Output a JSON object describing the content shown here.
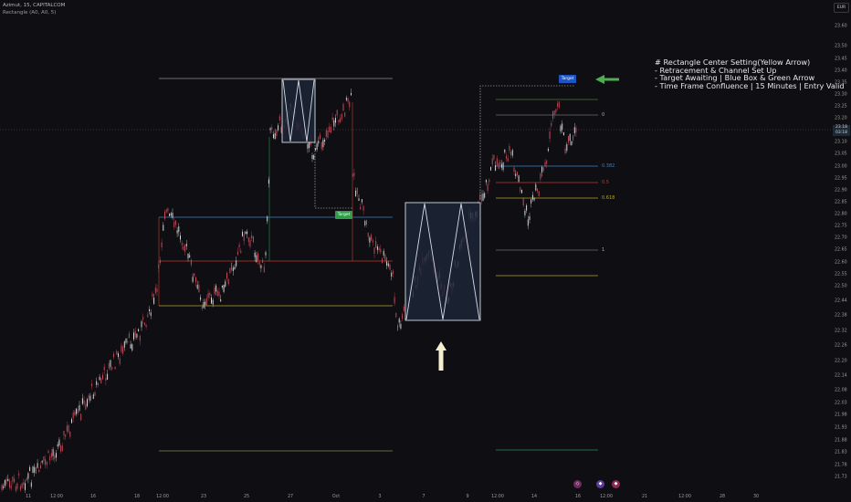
{
  "header": {
    "symbol_line": "Azimut, 15, CAPITALCOM",
    "indicator_line": "Rectangle (A0, A0, 5)"
  },
  "currency_button": "EUR",
  "price_axis": [
    {
      "value": 23.6,
      "label": "23.60"
    },
    {
      "value": 23.5,
      "label": "23.50"
    },
    {
      "value": 23.45,
      "label": "23.45"
    },
    {
      "value": 23.4,
      "label": "23.40"
    },
    {
      "value": 23.35,
      "label": "23.35"
    },
    {
      "value": 23.3,
      "label": "23.30"
    },
    {
      "value": 23.25,
      "label": "23.25"
    },
    {
      "value": 23.2,
      "label": "23.20"
    },
    {
      "value": 23.1,
      "label": "23.10"
    },
    {
      "value": 23.05,
      "label": "23.05"
    },
    {
      "value": 23.0,
      "label": "23.00"
    },
    {
      "value": 22.95,
      "label": "22.95"
    },
    {
      "value": 22.9,
      "label": "22.90"
    },
    {
      "value": 22.85,
      "label": "22.85"
    },
    {
      "value": 22.8,
      "label": "22.80"
    },
    {
      "value": 22.75,
      "label": "22.75"
    },
    {
      "value": 22.7,
      "label": "22.70"
    },
    {
      "value": 22.65,
      "label": "22.65"
    },
    {
      "value": 22.6,
      "label": "22.60"
    },
    {
      "value": 22.55,
      "label": "22.55"
    },
    {
      "value": 22.5,
      "label": "22.50"
    },
    {
      "value": 22.44,
      "label": "22.44"
    },
    {
      "value": 22.38,
      "label": "22.38"
    },
    {
      "value": 22.32,
      "label": "22.32"
    },
    {
      "value": 22.26,
      "label": "22.26"
    },
    {
      "value": 22.2,
      "label": "22.20"
    },
    {
      "value": 22.14,
      "label": "22.14"
    },
    {
      "value": 22.08,
      "label": "22.08"
    },
    {
      "value": 22.03,
      "label": "22.03"
    },
    {
      "value": 21.98,
      "label": "21.98"
    },
    {
      "value": 21.93,
      "label": "21.93"
    },
    {
      "value": 21.88,
      "label": "21.88"
    },
    {
      "value": 21.83,
      "label": "21.83"
    },
    {
      "value": 21.78,
      "label": "21.78"
    },
    {
      "value": 21.73,
      "label": "21.73"
    }
  ],
  "price_tag": {
    "line1": "23.18",
    "line2": "03:18"
  },
  "time_axis": [
    "11",
    "12:00",
    "16",
    "18",
    "12:00",
    "23",
    "25",
    "27",
    "Oct",
    "3",
    "7",
    "9",
    "12:00",
    "14",
    "16",
    "12:00",
    "21",
    "12:00",
    "28",
    "30"
  ],
  "fib_labels": [
    "0",
    "0.382",
    "0.5",
    "0.618",
    "1"
  ],
  "badges": {
    "green": "Target",
    "blue": "Target"
  },
  "note_lines": [
    "# Rectangle Center Setting(Yellow Arrow)",
    "- Retracement & Channel Set Up",
    "- Target Awaiting | Blue Box & Green Arrow",
    "- Time Frame Confluence | 15 Minutes | Entry Valid"
  ],
  "event_icons": [
    "dividend-icon",
    "earnings-icon",
    "earnings-icon"
  ],
  "colors": {
    "background": "#0f0f13",
    "fib_blue": "#3b82c4",
    "fib_red": "#c0392b",
    "fib_gold": "#b7a22a",
    "fib_green": "#2e8b57",
    "box_fill": "#1c2638",
    "green_arrow": "#4caf50",
    "yellow_arrow": "#f3efcf",
    "badge_green": "#2e9e48",
    "badge_blue": "#1e55c4"
  }
}
